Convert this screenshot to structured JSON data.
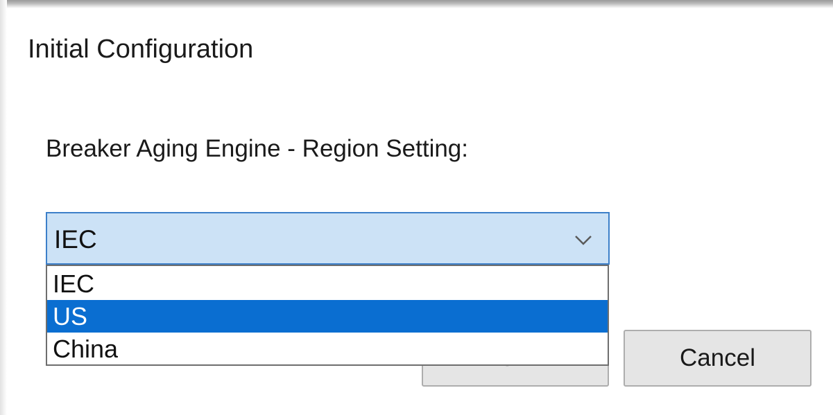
{
  "dialog": {
    "title": "Initial Configuration"
  },
  "region": {
    "label": "Breaker Aging Engine - Region Setting:",
    "selected_value": "IEC",
    "options": [
      {
        "label": "IEC",
        "highlighted": false
      },
      {
        "label": "US",
        "highlighted": true
      },
      {
        "label": "China",
        "highlighted": false
      }
    ],
    "arrow_icon": "chevron-down-icon"
  },
  "buttons": {
    "ok_label": "OK",
    "cancel_label": "Cancel"
  },
  "colors": {
    "combo_background": "#cce2f6",
    "combo_border": "#3c7fc9",
    "highlight": "#0a6ed1"
  }
}
